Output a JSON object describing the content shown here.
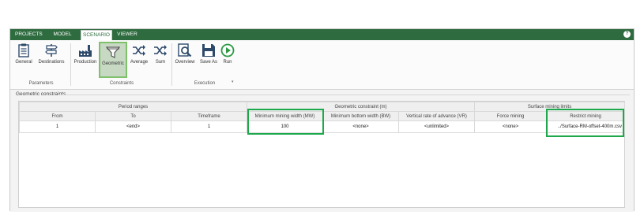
{
  "menu": {
    "tabs": [
      "PROJECTS",
      "MODEL",
      "SCENARIO",
      "VIEWER"
    ],
    "active_tab": "SCENARIO",
    "help_icon": "?"
  },
  "ribbon": {
    "parameters": {
      "general": "General",
      "destinations": "Destinations",
      "group": "Parameters"
    },
    "constraints": {
      "production": "Production",
      "geometric": "Geometric",
      "average": "Average",
      "sum": "Sum",
      "group": "Constraints"
    },
    "execution": {
      "overview": "Overview",
      "save_as": "Save As",
      "run": "Run",
      "group": "Execution"
    },
    "icons": [
      "clipboard-icon",
      "signpost-icon",
      "factory-icon",
      "funnel-icon",
      "shuffle-icon",
      "shuffle-icon",
      "magnifier-report-icon",
      "save-icon",
      "play-icon"
    ],
    "accent": "#2e6b3f",
    "highlight": "#1da84c"
  },
  "section": {
    "title": "Geometric constraints"
  },
  "table": {
    "groups": [
      "Period ranges",
      "Geometric constraint (m)",
      "Surface mining limits"
    ],
    "columns": [
      "From",
      "To",
      "Timeframe",
      "Minimum mining width (MW)",
      "Minimum bottom width (BW)",
      "Vertical rate of advance (VR)",
      "Force mining",
      "Restrict mining"
    ],
    "rows": [
      {
        "from": "1",
        "to": "<end>",
        "timeframe": "1",
        "mw": "100",
        "bw": "<none>",
        "vr": "<unlimited>",
        "force": "<none>",
        "restrict": "../Surface-RM-offset-400m.csv"
      }
    ]
  }
}
